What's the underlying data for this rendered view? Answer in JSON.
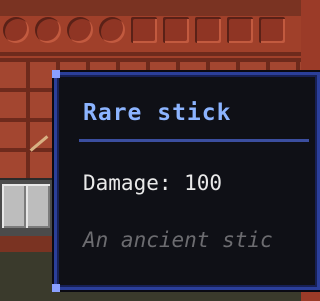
{
  "tooltip": {
    "item_name": "Rare stick",
    "damage_line": "Damage: 100",
    "lore_line": "An ancient stic"
  },
  "colors": {
    "item_name": "#8cb4ff",
    "tooltip_border": "#2b3f9a",
    "tooltip_background": "#0f1016",
    "wall": "#a0402a"
  }
}
